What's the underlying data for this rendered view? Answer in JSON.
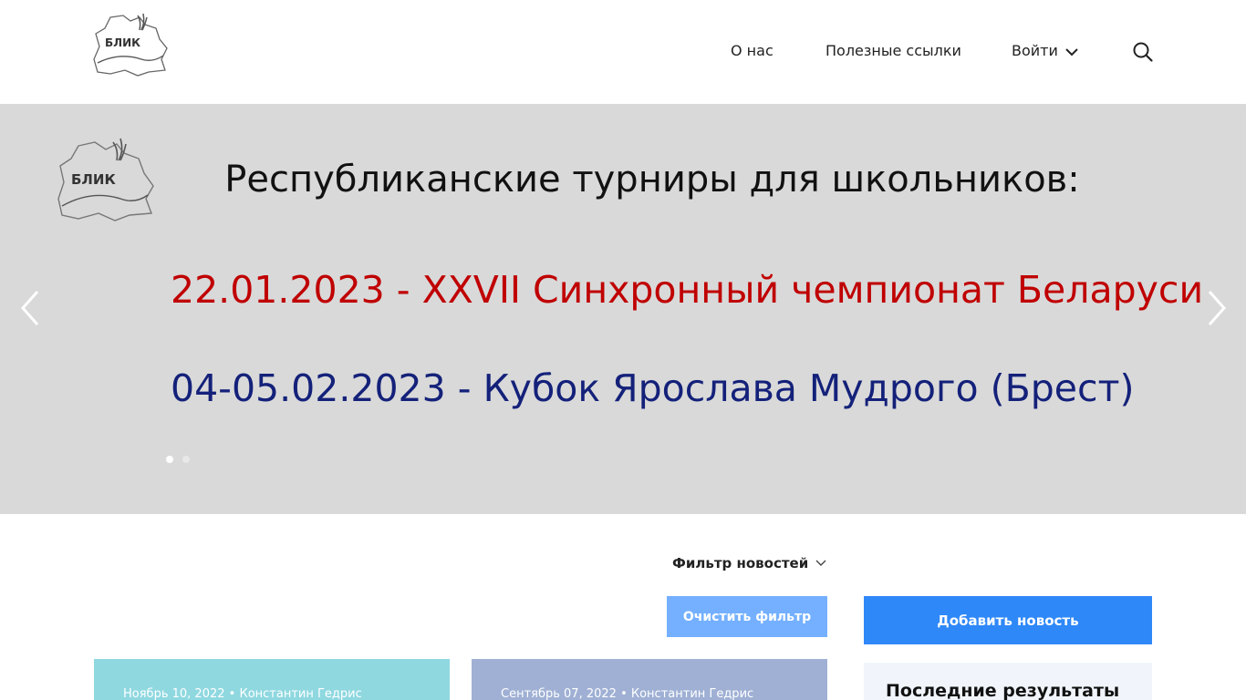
{
  "header": {
    "logo_text": "БЛИК",
    "nav": {
      "about": "О нас",
      "useful_links": "Полезные ссылки",
      "login": "Войти"
    },
    "search_icon": "search-icon"
  },
  "slider": {
    "logo_text": "БЛИК",
    "title": "Республиканские турниры для школьников:",
    "line1": "22.01.2023 - XXVII Синхронный чемпионат Беларуси",
    "line2": "04-05.02.2023 - Кубок Ярослава Мудрого (Брест)",
    "line1_color": "#c00000",
    "line2_color": "#14217a",
    "slide_count": 2,
    "active_slide": 1
  },
  "filter": {
    "toggle_label": "Фильтр новостей",
    "clear_label": "Очистить фильтр"
  },
  "sidebar": {
    "add_news_label": "Добавить новость",
    "results_title": "Последние результаты"
  },
  "news": [
    {
      "date": "Ноябрь 10, 2022",
      "author": "Константин Гедрис",
      "color": "#8fd8e0"
    },
    {
      "date": "Сентябрь 07, 2022",
      "author": "Константин Гедрис",
      "color": "#9fb0d4"
    }
  ],
  "colors": {
    "accent": "#2f88f8",
    "accent_light": "#74b0ff",
    "slider_bg": "#d9d9d9"
  }
}
